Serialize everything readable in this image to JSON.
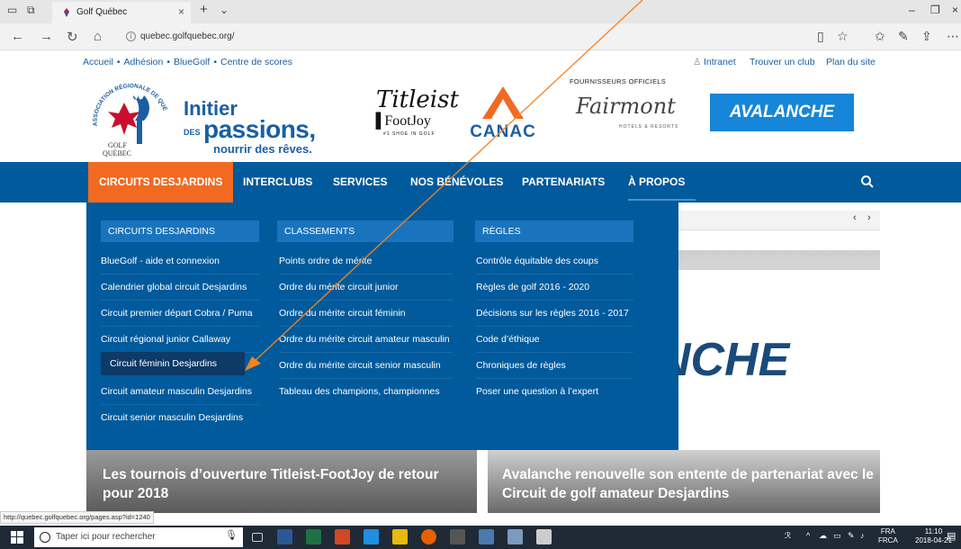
{
  "browser": {
    "tab_title": "Golf Québec",
    "url": "quebec.golfquebec.org/",
    "status_url": "http://quebec.golfquebec.org/pages.asp?id=1240"
  },
  "site": {
    "top_links": [
      "Accueil",
      "Adhésion",
      "BlueGolf",
      "Centre de scores"
    ],
    "top_sep": "•",
    "right_links": [
      "Intranet",
      "Trouver un club",
      "Plan du site"
    ],
    "logo": {
      "ring": "ASSOCIATION RÉGIONALE DE QUÉBEC",
      "line1": "GOLF",
      "line2": "QUÉBEC"
    },
    "tagline": {
      "line1": "Initier",
      "des": "DES",
      "line2": "passions,",
      "line3": "nourrir des rêves."
    },
    "sponsors": {
      "titleist": "Titleist",
      "footjoy": "FootJoy",
      "footjoy_sub": "#1 SHOE IN GOLF",
      "canac": "CANAC",
      "official_suppliers": "FOURNISSEURS OFFICIELS",
      "fairmont": "Fairmont",
      "fairmont_sub": "HOTELS & RESORTS",
      "avalanche": "AVALANCHE"
    },
    "nav": [
      {
        "label": "CIRCUITS DESJARDINS",
        "active": true
      },
      {
        "label": "INTERCLUBS"
      },
      {
        "label": "SERVICES"
      },
      {
        "label": "NOS BÉNÉVOLES"
      },
      {
        "label": "PARTENARIATS"
      },
      {
        "label": "À PROPOS"
      }
    ],
    "carousel": {
      "prev": "‹",
      "next": "›"
    },
    "bg_text": "NCHE",
    "news": [
      {
        "title": "Les tournois d’ouverture Titleist-FootJoy de retour pour 2018"
      },
      {
        "title": "Avalanche renouvelle son entente de partenariat avec le Circuit de golf amateur Desjardins"
      }
    ]
  },
  "dropdown": {
    "columns": [
      {
        "heading": "CIRCUITS DESJARDINS",
        "items": [
          "BlueGolf - aide et connexion",
          "Calendrier global circuit Desjardins",
          "Circuit premier départ Cobra / Puma",
          "Circuit régional junior Callaway",
          "Circuit féminin Desjardins",
          "Circuit amateur masculin Desjardins",
          "Circuit senior masculin Desjardins"
        ],
        "highlighted_index": 4
      },
      {
        "heading": "CLASSEMENTS",
        "items": [
          "Points ordre de mérite",
          "Ordre du mérite circuit junior",
          "Ordre du mérite circuit féminin",
          "Ordre du mérite circuit amateur masculin",
          "Ordre du mérite circuit senior masculin",
          "Tableau des champions, championnes"
        ]
      },
      {
        "heading": "RÈGLES",
        "items": [
          "Contrôle équitable des coups",
          "Règles  de golf 2016 - 2020",
          "Décisions sur les règles 2016 - 2017",
          "Code d’éthique",
          "Chroniques de règles",
          "Poser une question à l’expert"
        ]
      }
    ]
  },
  "taskbar": {
    "search_placeholder": "Taper ici pour rechercher",
    "lang1": "FRA",
    "lang2": "FRCA",
    "time": "11:10",
    "date": "2018-04-21"
  },
  "colors": {
    "nav_blue": "#005a9c",
    "active_orange": "#f26a21",
    "column_head": "#1a74bd",
    "highlight": "#0d3a66",
    "arrow": "#f5821f"
  }
}
